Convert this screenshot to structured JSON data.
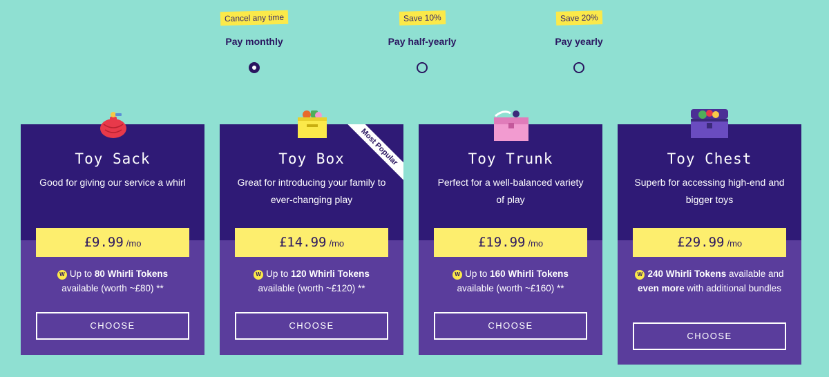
{
  "billing_options": [
    {
      "tag": "Cancel any time",
      "label": "Pay monthly",
      "selected": true
    },
    {
      "tag": "Save 10%",
      "label": "Pay half-yearly",
      "selected": false
    },
    {
      "tag": "Save 20%",
      "label": "Pay yearly",
      "selected": false
    }
  ],
  "plans": [
    {
      "name": "Toy Sack",
      "description": "Good for giving our service a whirl",
      "price": "£9.99",
      "unit": "/mo",
      "tokens_prefix": "Up to ",
      "tokens_bold": "80 Whirli Tokens",
      "tokens_suffix": "available (worth ~£80) **",
      "button": "CHOOSE"
    },
    {
      "name": "Toy Box",
      "description": "Great for introducing your family to ever-changing play",
      "price": "£14.99",
      "unit": "/mo",
      "tokens_prefix": "Up to ",
      "tokens_bold": "120 Whirli Tokens",
      "tokens_suffix": "available (worth ~£120) **",
      "button": "CHOOSE",
      "ribbon": "Most Popular"
    },
    {
      "name": "Toy Trunk",
      "description": "Perfect for a well-balanced variety of play",
      "price": "£19.99",
      "unit": "/mo",
      "tokens_prefix": "Up to ",
      "tokens_bold": "160 Whirli Tokens",
      "tokens_suffix": "available (worth ~£160) **",
      "button": "CHOOSE"
    },
    {
      "name": "Toy Chest",
      "description": "Superb for accessing high-end and bigger toys",
      "price": "£29.99",
      "unit": "/mo",
      "tokens_bold": "240 Whirli Tokens",
      "tokens_mid": " available and ",
      "tokens_bold2": "even more",
      "tokens_suffix": " with additional bundles",
      "button": "CHOOSE"
    }
  ],
  "coin_letter": "W",
  "colors": {
    "background": "#8fe0d2",
    "card_top": "#2f1a76",
    "card_bottom": "#5a3d9c",
    "price_bg": "#fdee6e",
    "tag_bg": "#fbe94a",
    "text_dark": "#2a1660"
  },
  "icons": [
    "sack-illustration",
    "box-illustration",
    "trunk-illustration",
    "chest-illustration",
    "whirli-token-icon"
  ]
}
